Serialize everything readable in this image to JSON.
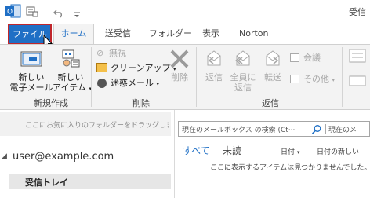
{
  "titlebar": {
    "app_icon": "outlook-icon",
    "window_title_partial": "受信"
  },
  "tabs": {
    "file": "ファイル",
    "home": "ホーム",
    "send_receive": "送受信",
    "folder": "フォルダー",
    "view": "表示",
    "norton": "Norton"
  },
  "ribbon": {
    "new_email_line1": "新しい",
    "new_email_line2": "電子メール",
    "new_items_line1": "新しい",
    "new_items_line2": "アイテム",
    "group_new": "新規作成",
    "ignore": "無視",
    "cleanup": "クリーンアップ",
    "junk": "迷惑メール",
    "delete": "削除",
    "group_delete": "削除",
    "reply": "返信",
    "reply_all_line1": "全員に",
    "reply_all_line2": "返信",
    "forward": "転送",
    "meeting": "会議",
    "more": "その他",
    "group_respond": "返信"
  },
  "nav": {
    "favorites_hint": "ここにお気に入りのフォルダーをドラッグしま",
    "account": "user@example.com",
    "inbox": "受信トレイ"
  },
  "list": {
    "search_placeholder": "現在のメールボックス の検索 (Ct···",
    "scope": "現在のメ",
    "filter_all": "すべて",
    "filter_unread": "未読",
    "sort_by": "日付",
    "order": "日付の新しい",
    "empty_message": "ここに表示するアイテムは見つかりませんでした。"
  },
  "colors": {
    "file_tab": "#1f6fc5",
    "file_tab_border": "#c0262b",
    "accent": "#1f6fc5"
  }
}
